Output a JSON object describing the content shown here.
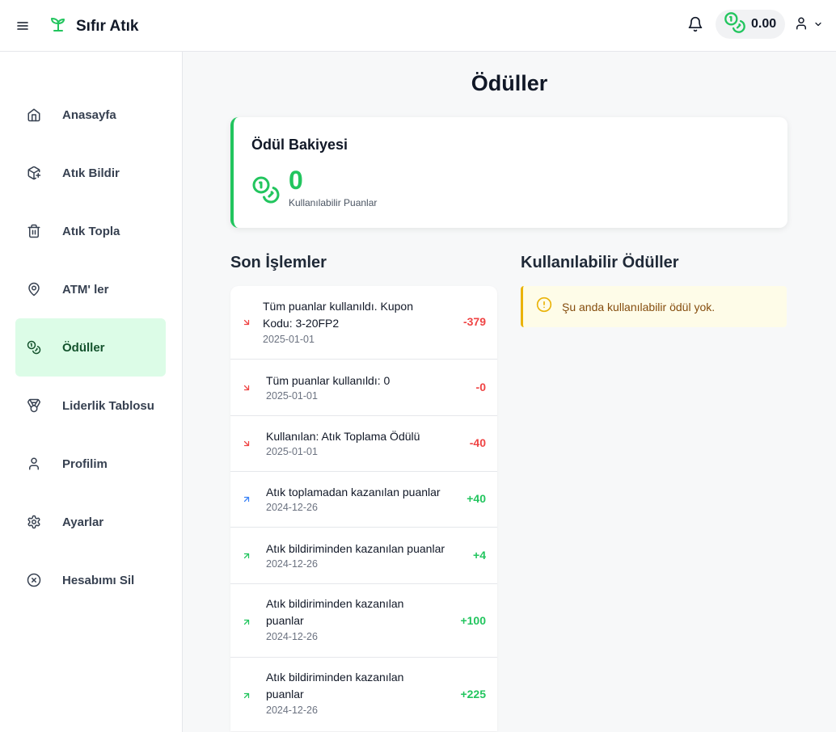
{
  "header": {
    "brand": "Sıfır Atık",
    "balance": "0.00"
  },
  "sidebar": {
    "items": [
      {
        "label": "Anasayfa",
        "icon": "home-icon"
      },
      {
        "label": "Atık Bildir",
        "icon": "box-plus-icon"
      },
      {
        "label": "Atık Topla",
        "icon": "trash-icon"
      },
      {
        "label": "ATM' ler",
        "icon": "map-pin-icon"
      },
      {
        "label": "Ödüller",
        "icon": "coins-icon",
        "active": true
      },
      {
        "label": "Liderlik Tablosu",
        "icon": "medal-icon"
      },
      {
        "label": "Profilim",
        "icon": "user-icon"
      },
      {
        "label": "Ayarlar",
        "icon": "gear-icon"
      },
      {
        "label": "Hesabımı Sil",
        "icon": "circle-x-icon"
      }
    ]
  },
  "main": {
    "title": "Ödüller",
    "balance_card": {
      "title": "Ödül Bakiyesi",
      "points": "0",
      "caption": "Kullanılabilir Puanlar"
    },
    "recent": {
      "title": "Son İşlemler",
      "transactions": [
        {
          "line1": "Tüm puanlar kullanıldı. Kupon",
          "line2": "Kodu: 3-20FP2",
          "date": "2025-01-01",
          "amount": "-379",
          "direction": "down"
        },
        {
          "line1": "Tüm puanlar kullanıldı: 0",
          "line2": "",
          "date": "2025-01-01",
          "amount": "-0",
          "direction": "down"
        },
        {
          "line1": "Kullanılan: Atık Toplama Ödülü",
          "line2": "",
          "date": "2025-01-01",
          "amount": "-40",
          "direction": "down"
        },
        {
          "line1": "Atık toplamadan kazanılan puanlar",
          "line2": "",
          "date": "2024-12-26",
          "amount": "+40",
          "direction": "up-blue"
        },
        {
          "line1": "Atık bildiriminden kazanılan puanlar",
          "line2": "",
          "date": "2024-12-26",
          "amount": "+4",
          "direction": "up"
        },
        {
          "line1": "Atık bildiriminden kazanılan",
          "line2": "puanlar",
          "date": "2024-12-26",
          "amount": "+100",
          "direction": "up"
        },
        {
          "line1": "Atık bildiriminden kazanılan",
          "line2": "puanlar",
          "date": "2024-12-26",
          "amount": "+225",
          "direction": "up"
        }
      ]
    },
    "available": {
      "title": "Kullanılabilir Ödüller",
      "empty_message": "Şu anda kullanılabilir ödül yok."
    }
  },
  "colors": {
    "brand_green": "#22c55e",
    "negative_red": "#ef4444",
    "active_nav_bg": "#dcfce7",
    "warning_yellow": "#eab308"
  }
}
